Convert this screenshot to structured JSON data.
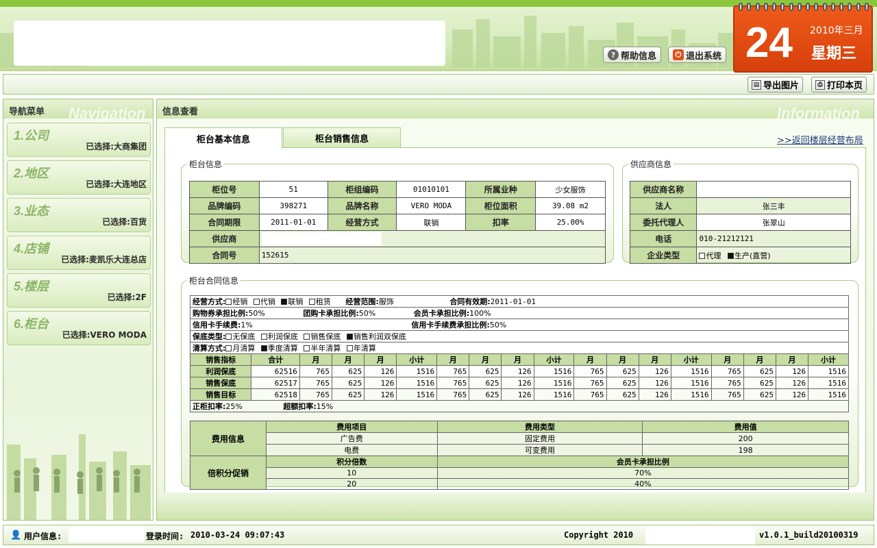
{
  "header": {
    "help_label": "帮助信息",
    "logout_label": "退出系统"
  },
  "calendar": {
    "day": "24",
    "year_month": "2010年三月",
    "weekday": "星期三"
  },
  "toolbar": {
    "export_label": "导出图片",
    "print_label": "打印本页"
  },
  "nav": {
    "title": "导航菜单",
    "watermark": "Navigation",
    "items": [
      {
        "label": "1.公司",
        "selected": "已选择:大商集团"
      },
      {
        "label": "2.地区",
        "selected": "已选择:大连地区"
      },
      {
        "label": "3.业态",
        "selected": "已选择:百货"
      },
      {
        "label": "4.店铺",
        "selected": "已选择:麦凯乐大连总店"
      },
      {
        "label": "5.楼层",
        "selected": "已选择:2F"
      },
      {
        "label": "6.柜台",
        "selected": "已选择:VERO MODA"
      }
    ]
  },
  "main": {
    "title": "信息查看",
    "watermark": "Information",
    "tabs": [
      "柜台基本信息",
      "柜台销售信息"
    ],
    "back_link": ">>返回楼层经营布局"
  },
  "counter_info": {
    "legend": "柜台信息",
    "labels": {
      "pos_no": "柜位号",
      "group_code": "柜组编码",
      "industry": "所属业种",
      "brand_code": "品牌编码",
      "brand_name": "品牌名称",
      "area": "柜位面积",
      "contract_period": "合同期限",
      "mode": "经营方式",
      "rate": "扣率",
      "supplier": "供应商",
      "contract_no": "合同号"
    },
    "values": {
      "pos_no": "51",
      "group_code": "01010101",
      "industry": "少女服饰",
      "brand_code": "398271",
      "brand_name": "VERO MODA",
      "area": "39.08 m2",
      "contract_period": "2011-01-01",
      "mode": "联销",
      "rate": "25.00%",
      "contract_no": "152615"
    }
  },
  "supplier_info": {
    "legend": "供应商信息",
    "labels": {
      "name": "供应商名称",
      "legal": "法人",
      "agent": "委托代理人",
      "phone": "电话",
      "type": "企业类型"
    },
    "values": {
      "legal": "张三丰",
      "agent": "张翠山",
      "phone": "010-21212121"
    },
    "type_options": [
      {
        "label": "代理",
        "checked": false
      },
      {
        "label": "生产(直营)",
        "checked": true
      }
    ]
  },
  "contract": {
    "legend": "柜台合同信息",
    "mode_label": "经营方式:",
    "mode_options": [
      {
        "label": "经销",
        "checked": false
      },
      {
        "label": "代销",
        "checked": false
      },
      {
        "label": "联销",
        "checked": true
      },
      {
        "label": "租赁",
        "checked": false
      }
    ],
    "scope_label": "经营范围:",
    "scope_value": "服饰",
    "valid_label": "合同有效期:",
    "valid_value": "2011-01-01",
    "voucher_label": "购物券承担比例:",
    "voucher_value": "50%",
    "group_card_label": "团购卡承担比例:",
    "group_card_value": "50%",
    "member_card_label": "会员卡承担比例:",
    "member_card_value": "100%",
    "credit_fee_label": "信用卡手续费:",
    "credit_fee_value": "1%",
    "credit_share_label": "信用卡手续费承担比例:",
    "credit_share_value": "50%",
    "guarantee_label": "保底类型:",
    "guarantee_options": [
      {
        "label": "无保底",
        "checked": false
      },
      {
        "label": "利润保底",
        "checked": false
      },
      {
        "label": "销售保底",
        "checked": false
      },
      {
        "label": "销售利润双保底",
        "checked": true
      }
    ],
    "settle_label": "清算方式:",
    "settle_options": [
      {
        "label": "月清算",
        "checked": false
      },
      {
        "label": "季度清算",
        "checked": true
      },
      {
        "label": "半年清算",
        "checked": false
      },
      {
        "label": "年清算",
        "checked": false
      }
    ],
    "sales_header": [
      "销售指标",
      "合计",
      "月",
      "月",
      "月",
      "小计",
      "月",
      "月",
      "月",
      "小计",
      "月",
      "月",
      "月",
      "小计",
      "月",
      "月",
      "月",
      "小计"
    ],
    "sales_rows": [
      {
        "name": "利润保底",
        "values": [
          "62516",
          "765",
          "625",
          "126",
          "1516",
          "765",
          "625",
          "126",
          "1516",
          "765",
          "625",
          "126",
          "1516",
          "765",
          "625",
          "126",
          "1516"
        ]
      },
      {
        "name": "销售保底",
        "values": [
          "62517",
          "765",
          "625",
          "126",
          "1516",
          "765",
          "625",
          "126",
          "1516",
          "765",
          "625",
          "126",
          "1516",
          "765",
          "625",
          "126",
          "1516"
        ]
      },
      {
        "name": "销售目标",
        "values": [
          "62518",
          "765",
          "625",
          "126",
          "1516",
          "765",
          "625",
          "126",
          "1516",
          "765",
          "625",
          "126",
          "1516",
          "765",
          "625",
          "126",
          "1516"
        ]
      }
    ],
    "normal_rate_label": "正柜扣率:",
    "normal_rate_value": "25%",
    "over_rate_label": "超额扣率:",
    "over_rate_value": "15%",
    "fee_title": "费用信息",
    "fee_header": [
      "费用项目",
      "费用类型",
      "费用值"
    ],
    "fee_rows": [
      [
        "广告费",
        "固定费用",
        "200"
      ],
      [
        "电费",
        "可变费用",
        "198"
      ]
    ],
    "points_title": "倍积分促销",
    "points_header": [
      "积分倍数",
      "会员卡承担比例"
    ],
    "points_rows": [
      [
        "10",
        "70%"
      ],
      [
        "20",
        "40%"
      ]
    ]
  },
  "status": {
    "user_label": "用户信息:",
    "login_label": "登录时间:",
    "login_time": "2010-03-24 09:07:43",
    "copyright": "Copyright 2010",
    "version": "v1.0.1_build20100319"
  },
  "colors": {
    "accent_green": "#8cc63f",
    "calendar_orange": "#e24a12",
    "header_cell": "#c6dda4"
  }
}
